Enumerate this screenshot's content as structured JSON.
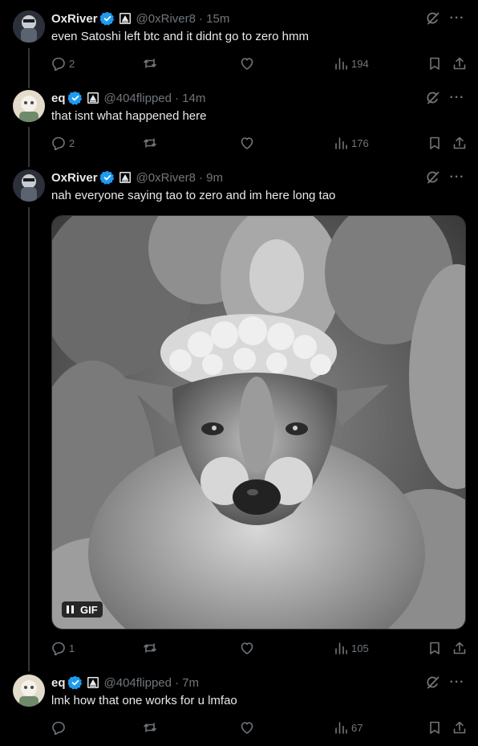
{
  "colors": {
    "background": "#000000",
    "text": "#e7e9ea",
    "muted": "#71767b",
    "verified": "#1d9bf0",
    "thread_line": "#333639"
  },
  "icons": [
    "verified-badge-icon",
    "affiliation-icon",
    "grok-icon",
    "more-icon",
    "reply-icon",
    "retweet-icon",
    "like-icon",
    "views-icon",
    "bookmark-icon",
    "share-icon",
    "pause-icon"
  ],
  "tweets": [
    {
      "name": "OxRiver",
      "handle": "@0xRiver8",
      "time": "· 15m",
      "text": "even Satoshi left btc and it didnt go to zero hmm",
      "replies": "2",
      "retweets": "",
      "likes": "",
      "views": "194"
    },
    {
      "name": "eq",
      "handle": "@404flipped",
      "time": "· 14m",
      "text": "that isnt what happened here",
      "replies": "2",
      "retweets": "",
      "likes": "",
      "views": "176"
    },
    {
      "name": "OxRiver",
      "handle": "@0xRiver8",
      "time": "· 9m",
      "text": "nah everyone saying tao to zero and im here long tao",
      "replies": "1",
      "retweets": "",
      "likes": "",
      "views": "105",
      "media": {
        "type": "gif",
        "badge": "GIF",
        "alt": ""
      }
    },
    {
      "name": "eq",
      "handle": "@404flipped",
      "time": "· 7m",
      "text": "lmk how that one works for u lmfao",
      "replies": "",
      "retweets": "",
      "likes": "",
      "views": "67"
    }
  ]
}
